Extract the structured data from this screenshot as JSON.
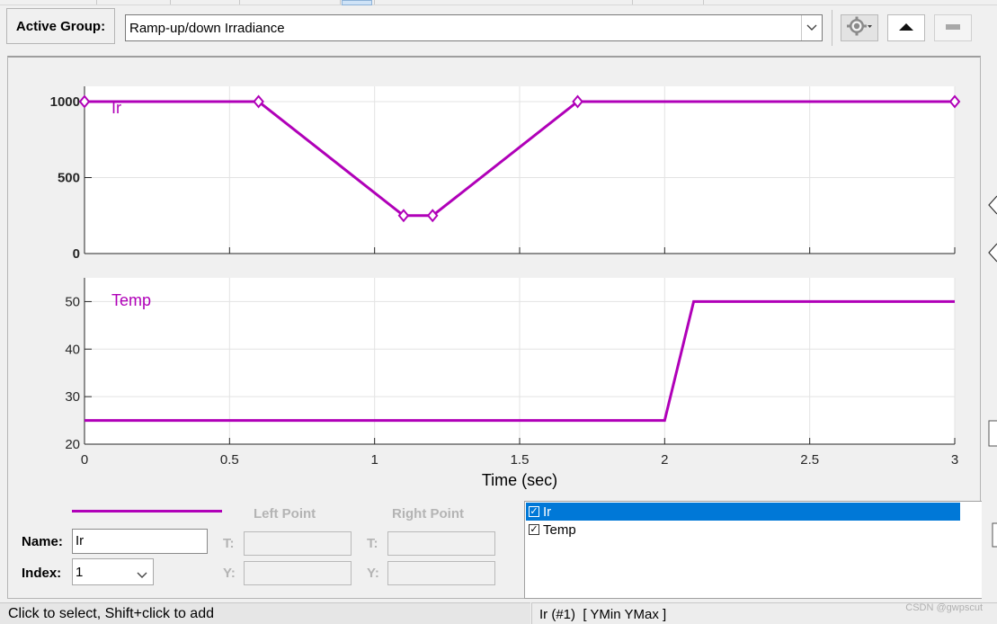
{
  "toolbar": {
    "active_group_label": "Active Group:",
    "active_group_value": "Ramp-up/down Irradiance",
    "settings_icon": "gear-icon",
    "move_up_icon": "triangle-up-icon",
    "move_down_icon": "triangle-down-icon"
  },
  "chart_data": [
    {
      "type": "line",
      "series": [
        {
          "name": "Ir",
          "color": "#b000b8",
          "x": [
            0,
            0.6,
            1.1,
            1.2,
            1.7,
            3
          ],
          "y": [
            1000,
            1000,
            250,
            250,
            1000,
            1000
          ],
          "markers": "diamond"
        }
      ],
      "ylim": [
        0,
        1000
      ],
      "xlim": [
        0,
        3
      ],
      "yticks": [
        "0",
        "500",
        "1000"
      ],
      "grid": true
    },
    {
      "type": "line",
      "series": [
        {
          "name": "Temp",
          "color": "#b000b8",
          "x": [
            0,
            2,
            2.1,
            3
          ],
          "y": [
            25,
            25,
            50,
            50
          ]
        }
      ],
      "ylim": [
        20,
        55
      ],
      "xlim": [
        0,
        3
      ],
      "yticks": [
        "20",
        "30",
        "40",
        "50"
      ],
      "xticks": [
        "0",
        "0.5",
        "1",
        "1.5",
        "2",
        "2.5",
        "3"
      ],
      "xlabel": "Time (sec)",
      "grid": true
    }
  ],
  "editor": {
    "line_color": "#b000b8",
    "left_point_label": "Left Point",
    "right_point_label": "Right Point",
    "name_label": "Name:",
    "name_value": "Ir",
    "index_label": "Index:",
    "index_value": "1",
    "t_label": "T:",
    "y_label": "Y:"
  },
  "signal_list": [
    {
      "label": "Ir",
      "checked": true,
      "selected": true
    },
    {
      "label": "Temp",
      "checked": true,
      "selected": false
    }
  ],
  "status": {
    "left_text": "Click to select, Shift+click to add",
    "right_text": "Ir (#1)  [ YMin YMax ]",
    "watermark": "CSDN @gwpscut"
  }
}
